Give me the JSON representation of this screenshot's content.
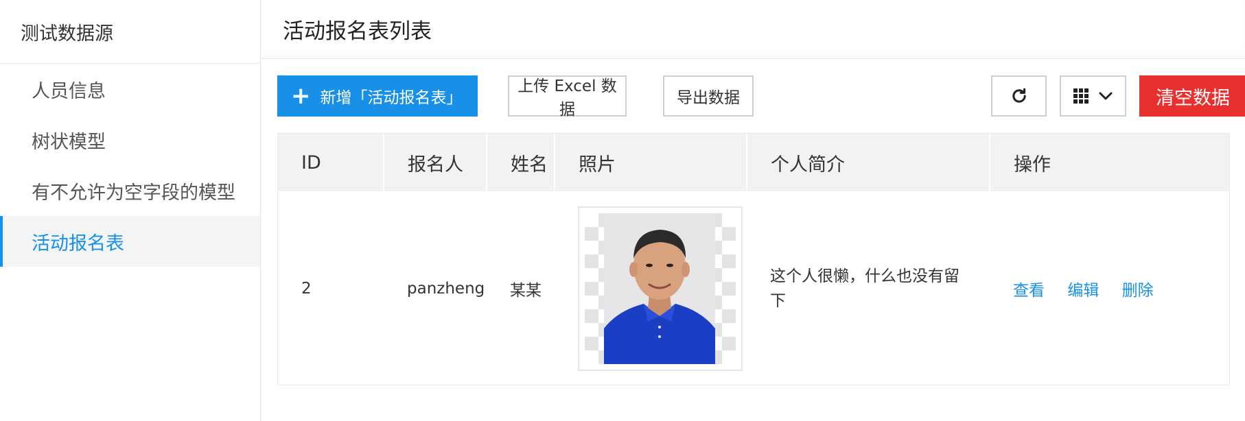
{
  "sidebar": {
    "title": "测试数据源",
    "items": [
      {
        "label": "人员信息",
        "active": false
      },
      {
        "label": "树状模型",
        "active": false
      },
      {
        "label": "有不允许为空字段的模型",
        "active": false
      },
      {
        "label": "活动报名表",
        "active": true
      }
    ]
  },
  "main": {
    "title": "活动报名表列表"
  },
  "toolbar": {
    "add_icon": "plus-icon",
    "add_label": "新增「活动报名表」",
    "upload_label": "上传 Excel 数据",
    "export_label": "导出数据",
    "refresh_icon": "refresh-icon",
    "grid_icon": "grid-icon",
    "chevron_icon": "chevron-down-icon",
    "clear_label": "清空数据"
  },
  "table": {
    "headers": [
      "ID",
      "报名人",
      "姓名",
      "照片",
      "个人简介",
      "操作"
    ],
    "rows": [
      {
        "id": "2",
        "registrant": "panzheng",
        "name": "某某",
        "photo": "portrait-photo",
        "bio": "这个人很懒，什么也没有留下",
        "actions": [
          "查看",
          "编辑",
          "删除"
        ]
      }
    ]
  },
  "colors": {
    "primary": "#1890e8",
    "danger": "#e8312f",
    "header_bg": "#f2f2f2",
    "sidebar_active_bg": "#f3f4f6"
  }
}
